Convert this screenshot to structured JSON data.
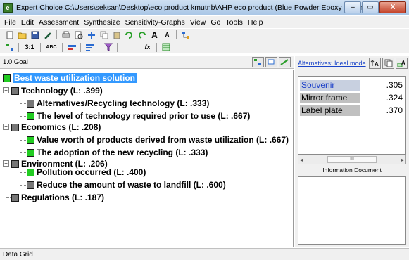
{
  "window": {
    "title": "Expert Choice   C:\\Users\\seksan\\Desktop\\eco product kmutnb\\AHP eco product (Blue Powder Epoxy Resin).ahp",
    "minimize": "–",
    "maximize": "▭",
    "close": "X"
  },
  "menu": [
    "File",
    "Edit",
    "Assessment",
    "Synthesize",
    "Sensitivity-Graphs",
    "View",
    "Go",
    "Tools",
    "Help"
  ],
  "toolbar2": {
    "ratio": "3:1",
    "abc": "ABC",
    "fx": "fx"
  },
  "goal_bar": {
    "label": "1.0 Goal"
  },
  "tree": {
    "goal": "Best waste utilization solution",
    "nodes": [
      {
        "label": "Technology (L: .399)"
      },
      {
        "label": "Alternatives/Recycling technology (L: .333)"
      },
      {
        "label": "The level of technology required prior to use (L: .667)"
      },
      {
        "label": "Economics (L: .208)"
      },
      {
        "label": "Value worth of products derived from waste utilization (L: .667)"
      },
      {
        "label": "The adoption of the new recycling (L: .333)"
      },
      {
        "label": "Environment (L: .206)"
      },
      {
        "label": "Pollution occurred (L: .400)"
      },
      {
        "label": "Reduce the amount of waste to landfill (L: .600)"
      },
      {
        "label": "Regulations (L: .187)"
      }
    ]
  },
  "right_panel": {
    "mode_link": "Alternatives: Ideal mode",
    "alternatives": [
      {
        "name": "Souvenir",
        "value": ".305"
      },
      {
        "name": "Mirror frame",
        "value": ".324"
      },
      {
        "name": "Label plate",
        "value": ".370"
      }
    ],
    "scroll_thumb": "III",
    "info_label": "Information Document"
  },
  "status": {
    "text": "Data Grid"
  },
  "colors": {
    "node_green": "#22cc22",
    "node_gray": "#777777",
    "selection": "#3399ff",
    "link": "#1a44c8"
  }
}
